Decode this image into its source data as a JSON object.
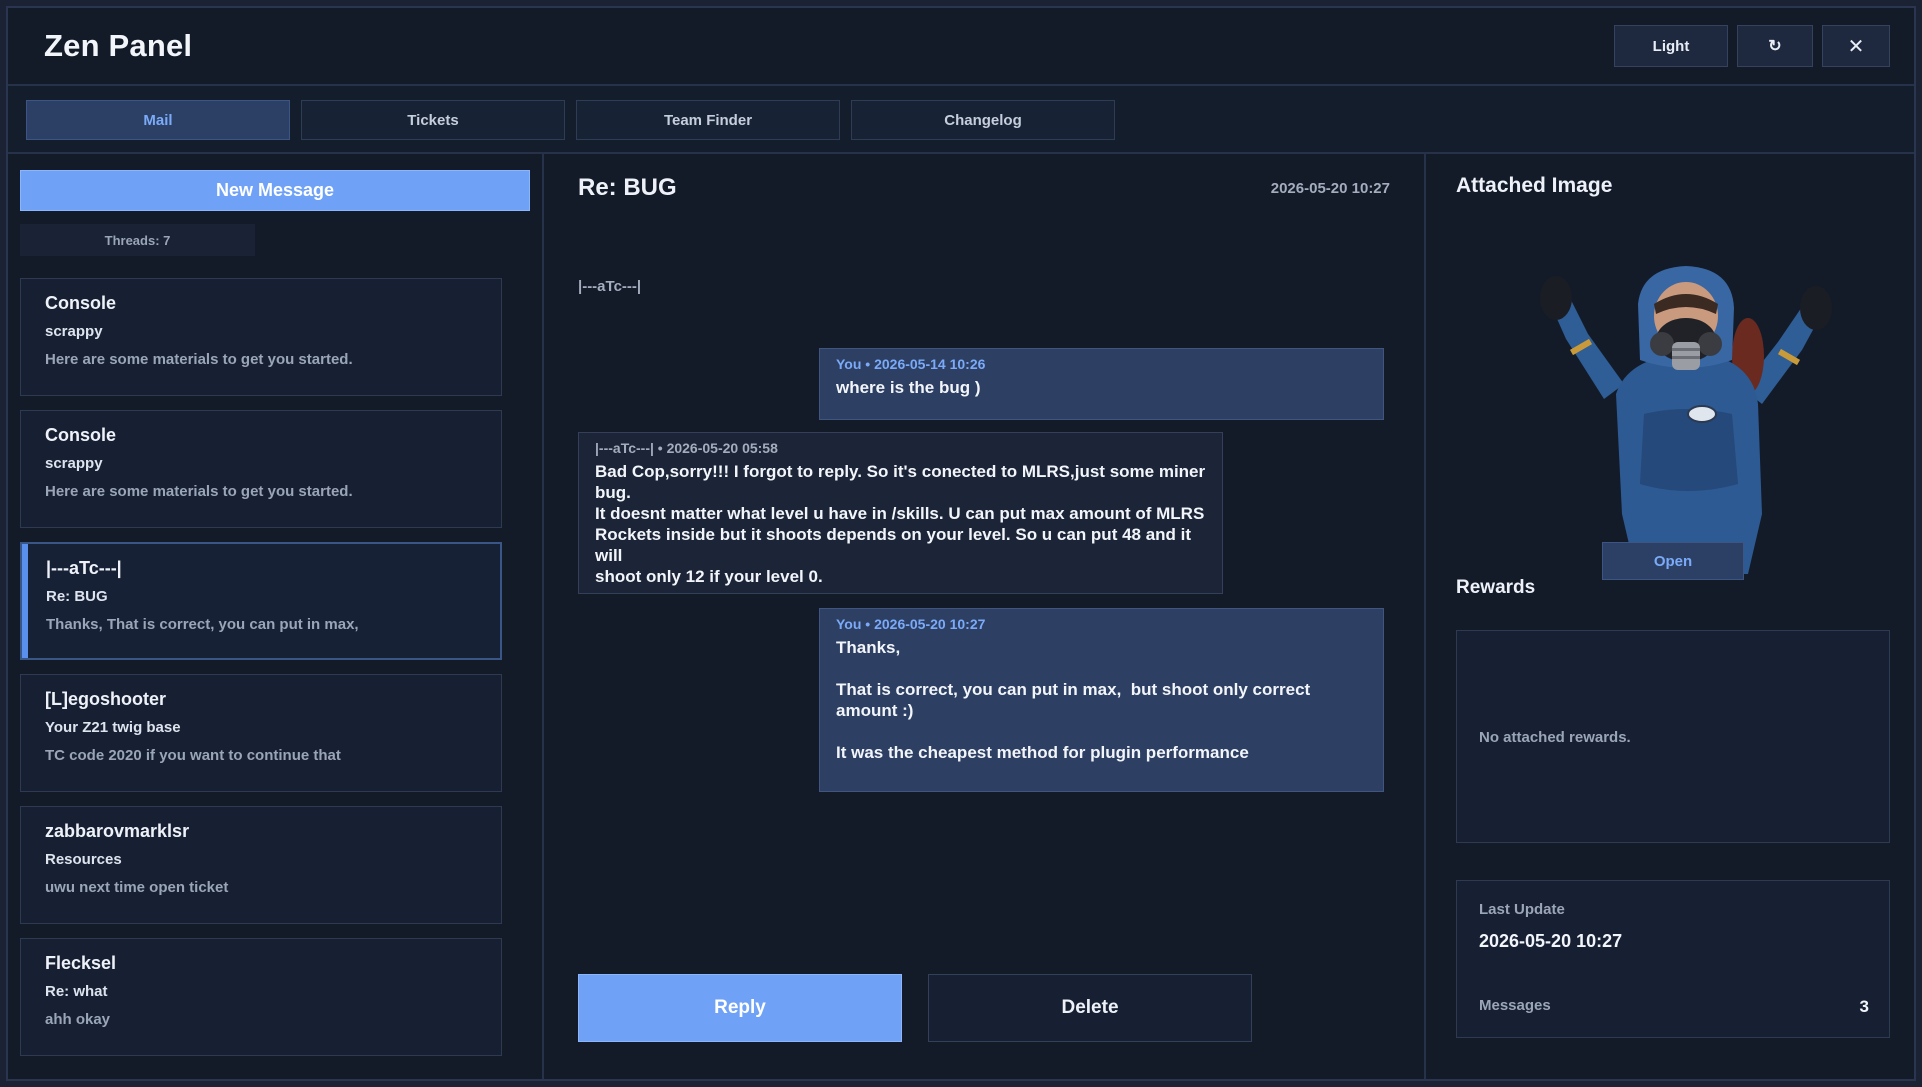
{
  "app": {
    "title": "Zen Panel"
  },
  "header": {
    "theme_label": "Light",
    "refresh_icon": "refresh-icon",
    "close_icon": "close-icon",
    "close_glyph": "✕",
    "refresh_glyph": "↻"
  },
  "tabs": [
    {
      "label": "Mail",
      "active": true
    },
    {
      "label": "Tickets",
      "active": false
    },
    {
      "label": "Team Finder",
      "active": false
    },
    {
      "label": "Changelog",
      "active": false
    }
  ],
  "sidebar": {
    "new_message_label": "New Message",
    "threads_count": "Threads: 7",
    "threads": [
      {
        "from": "Console",
        "subject": "scrappy",
        "preview": "Here are some materials to get you started."
      },
      {
        "from": "Console",
        "subject": "scrappy",
        "preview": "Here are some materials to get you started."
      },
      {
        "from": "|---aTc---|",
        "subject": "Re: BUG",
        "preview": "Thanks,   That is correct, you can put in max,",
        "active": true
      },
      {
        "from": "[L]egoshooter",
        "subject": "Your Z21 twig base",
        "preview": "TC code 2020 if you want to continue that"
      },
      {
        "from": "zabbarovmarklsr",
        "subject": "Resources",
        "preview": "uwu  next time open ticket"
      },
      {
        "from": "Flecksel",
        "subject": "Re: what",
        "preview": "ahh okay"
      }
    ]
  },
  "conversation": {
    "title": "Re: BUG",
    "date": "2026-05-20 10:27",
    "participant": "|---aTc---|",
    "messages": [
      {
        "meta": "You • 2026-05-14 10:26",
        "body": "where is the bug )"
      },
      {
        "meta": "|---aTc---| • 2026-05-20 05:58",
        "body": "Bad Cop,sorry!!! I forgot to reply. So it's conected to MLRS,just some miner bug.\nIt doesnt matter what level u have in /skills. U can put max amount of MLRS\nRockets inside but it shoots depends on your level. So u can put 48 and it will\nshoot only 12 if your level 0."
      },
      {
        "meta": "You • 2026-05-20 10:27",
        "body": "Thanks,\n\nThat is correct, you can put in max,  but shoot only correct amount :)\n\nIt was the cheapest method for plugin performance"
      }
    ],
    "reply_label": "Reply",
    "delete_label": "Delete"
  },
  "details": {
    "attached_title": "Attached Image",
    "open_label": "Open",
    "rewards_title": "Rewards",
    "rewards_empty": "No attached rewards.",
    "last_update_label": "Last Update",
    "last_update_value": "2026-05-20 10:27",
    "messages_label": "Messages",
    "messages_value": "3"
  },
  "colors": {
    "accent": "#6fa2f7",
    "panel": "#131b29",
    "card": "#172033",
    "you_bubble": "#2d3f63"
  }
}
